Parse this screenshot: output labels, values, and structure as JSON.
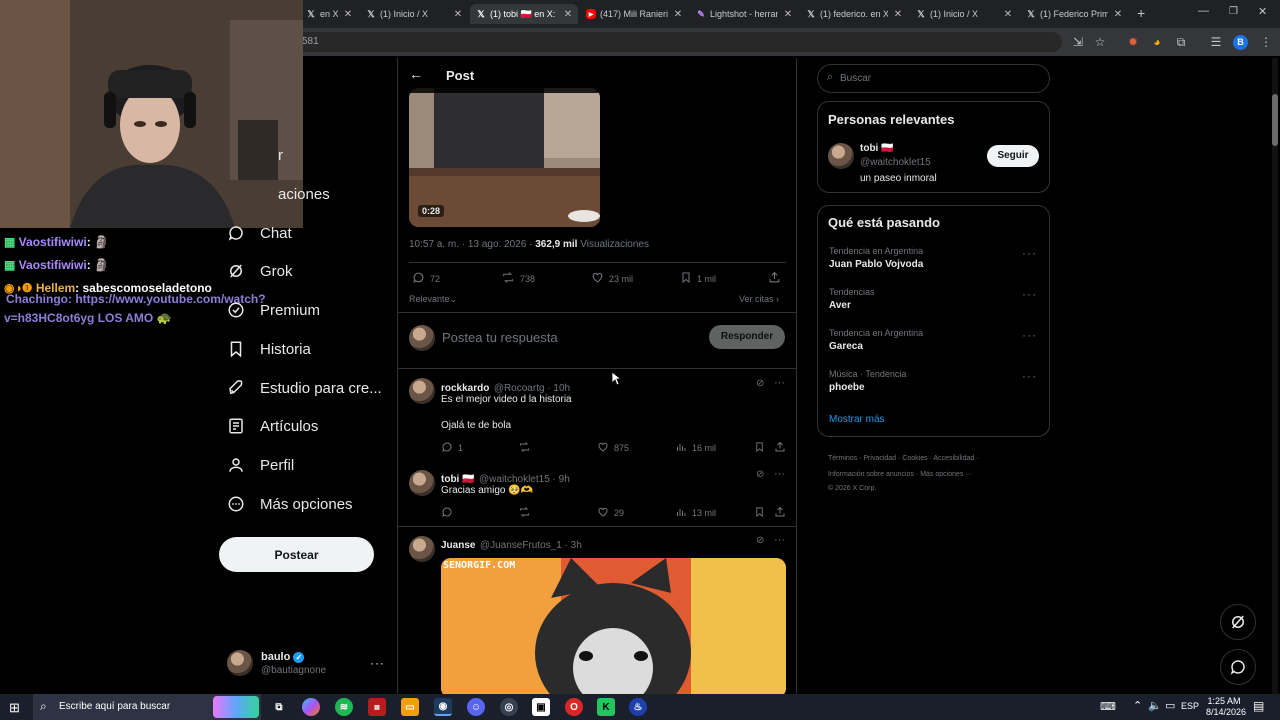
{
  "browser": {
    "tabs": [
      {
        "title": "en X",
        "icon": "x-logo-icon"
      },
      {
        "title": "(1) Inicio / X",
        "icon": "x-logo-icon"
      },
      {
        "title": "(1) tobi 🇵🇱 en X: \"",
        "icon": "x-logo-icon",
        "active": true
      },
      {
        "title": "(417) Mili Ranieri",
        "icon": "youtube-icon"
      },
      {
        "title": "Lightshot - herram",
        "icon": "lightshot-icon"
      },
      {
        "title": "(1) federico. en X",
        "icon": "x-logo-icon"
      },
      {
        "title": "(1) Inicio / X",
        "icon": "x-logo-icon"
      },
      {
        "title": "(1) Federico Prime",
        "icon": "x-logo-icon"
      }
    ],
    "url_fragment": "581",
    "profile_initial": "B"
  },
  "stream_chat": [
    {
      "user": "Vaostifiwiwi",
      "text": ": 🗿",
      "color": "#a78bfa"
    },
    {
      "user": "Vaostifiwiwi",
      "text": ": 🗿",
      "color": "#a78bfa"
    },
    {
      "user": "Hellem",
      "text": ": sabescomoseladetono",
      "color": "#e8b04a"
    },
    {
      "user": "Chachingo",
      "text": ": https://www.youtube.com/watch?",
      "color": "#8b7fd8"
    },
    {
      "user": "",
      "text": "v=h83HC8ot6yg LOS AMO 🐢",
      "color": "#8b7fd8"
    }
  ],
  "sidebar": {
    "items": [
      {
        "label": "r",
        "icon": "partial-icon"
      },
      {
        "label": "aciones",
        "icon": "partial-icon"
      },
      {
        "label": "Chat",
        "icon": "chat-icon"
      },
      {
        "label": "Grok",
        "icon": "grok-icon"
      },
      {
        "label": "Premium",
        "icon": "premium-icon"
      },
      {
        "label": "Historia",
        "icon": "bookmark-icon"
      },
      {
        "label": "Estudio para cre...",
        "icon": "studio-icon"
      },
      {
        "label": "Artículos",
        "icon": "articles-icon"
      },
      {
        "label": "Perfil",
        "icon": "profile-icon"
      },
      {
        "label": "Más opciones",
        "icon": "more-icon"
      }
    ],
    "post_button": "Postear",
    "account": {
      "name": "baulo",
      "handle": "@bautiagnone"
    }
  },
  "post": {
    "header_title": "Post",
    "video_duration": "0:28",
    "timestamp": "10:57 a. m. · 13 ago. 2026 · ",
    "views_count": "362,9 mil",
    "views_label": " Visualizaciones",
    "replies": "72",
    "reposts": "738",
    "likes": "23 mil",
    "bookmarks": "1 mil",
    "sort_label": "Relevante",
    "quotes_link": "Ver citas",
    "reply_placeholder": "Postea tu respuesta",
    "reply_button": "Responder"
  },
  "replies": [
    {
      "name": "rockkardo",
      "handle": "@Rocoartg · 10h",
      "text1": "Es el mejor video d la historia",
      "text2": "Ojalá te de bola",
      "replies": "1",
      "reposts": "",
      "likes": "875",
      "views": "16 mil"
    },
    {
      "name": "tobi 🇵🇱",
      "handle": "@waitchoklet15 · 9h",
      "text1": "Gracias amigo 🥺🫶",
      "text2": "",
      "replies": "",
      "reposts": "",
      "likes": "29",
      "views": "13 mil"
    },
    {
      "name": "Juanse",
      "handle": "@JuanseFrutos_1 · 3h",
      "gif_label": "SENORGIF.COM"
    }
  ],
  "right": {
    "search_placeholder": "Buscar",
    "relevant_title": "Personas relevantes",
    "relevant_person": {
      "name": "tobi 🇵🇱",
      "handle": "@waitchoklet15",
      "bio": "un paseo inmoral",
      "follow": "Seguir"
    },
    "trends_title": "Qué está pasando",
    "trends": [
      {
        "category": "Tendencia en Argentina",
        "name": "Juan Pablo Vojvoda"
      },
      {
        "category": "Tendencias",
        "name": "Aver"
      },
      {
        "category": "Tendencia en Argentina",
        "name": "Gareca"
      },
      {
        "category": "Música · Tendencia",
        "name": "phoebe"
      }
    ],
    "show_more": "Mostrar más",
    "footer_line1": "Términos · Privacidad · Cookies · Accesibilidad ·",
    "footer_line2": "Información sobre anuncios · Más opciones ···",
    "footer_line3": "© 2026 X Corp."
  },
  "taskbar": {
    "search_placeholder": "Escribe aquí para buscar",
    "lang": "ESP",
    "time": "1:25 AM",
    "date": "8/14/2026"
  },
  "colors": {
    "accent": "#1d9bf0",
    "background": "#000000",
    "border": "#2f3336",
    "muted": "#71767b"
  }
}
